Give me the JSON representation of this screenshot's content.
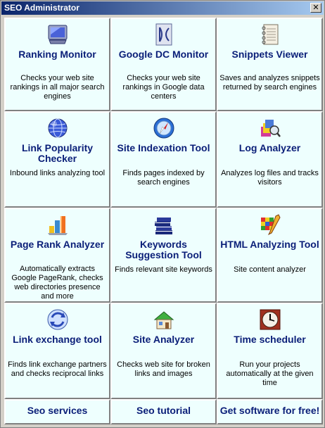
{
  "window": {
    "title": "SEO Administrator"
  },
  "tools": [
    {
      "name": "Ranking Monitor",
      "desc": "Checks your web site rankings in all major search engines",
      "icon": "monitor-icon"
    },
    {
      "name": "Google DC Monitor",
      "desc": "Checks your web site rankings in Google data centers",
      "icon": "dc-logo-icon"
    },
    {
      "name": "Snippets Viewer",
      "desc": "Saves and analyzes snippets returned by search engines",
      "icon": "notebook-icon"
    },
    {
      "name": "Link Popularity Checker",
      "desc": "Inbound links analyzing tool",
      "icon": "globe-icon"
    },
    {
      "name": "Site Indexation Tool",
      "desc": "Finds pages indexed by search engines",
      "icon": "compass-icon"
    },
    {
      "name": "Log Analyzer",
      "desc": "Analyzes log files and tracks visitors",
      "icon": "database-magnifier-icon"
    },
    {
      "name": "Page Rank Analyzer",
      "desc": "Automatically extracts Google PageRank, checks web directories presence and more",
      "icon": "bar-chart-icon"
    },
    {
      "name": "Keywords Suggestion Tool",
      "desc": "Finds relevant site keywords",
      "icon": "books-icon"
    },
    {
      "name": "HTML Analyzing Tool",
      "desc": "Site content analyzer",
      "icon": "color-grid-pencil-icon"
    },
    {
      "name": "Link exchange tool",
      "desc": "Finds link exchange partners and checks reciprocal links",
      "icon": "exchange-arrows-icon"
    },
    {
      "name": "Site Analyzer",
      "desc": "Checks web site for broken links and images",
      "icon": "house-icon"
    },
    {
      "name": "Time scheduler",
      "desc": "Run your projects automatically at the given time",
      "icon": "clock-icon"
    }
  ],
  "footer": [
    {
      "label": "Seo services"
    },
    {
      "label": "Seo tutorial"
    },
    {
      "label": "Get software for free!"
    }
  ]
}
